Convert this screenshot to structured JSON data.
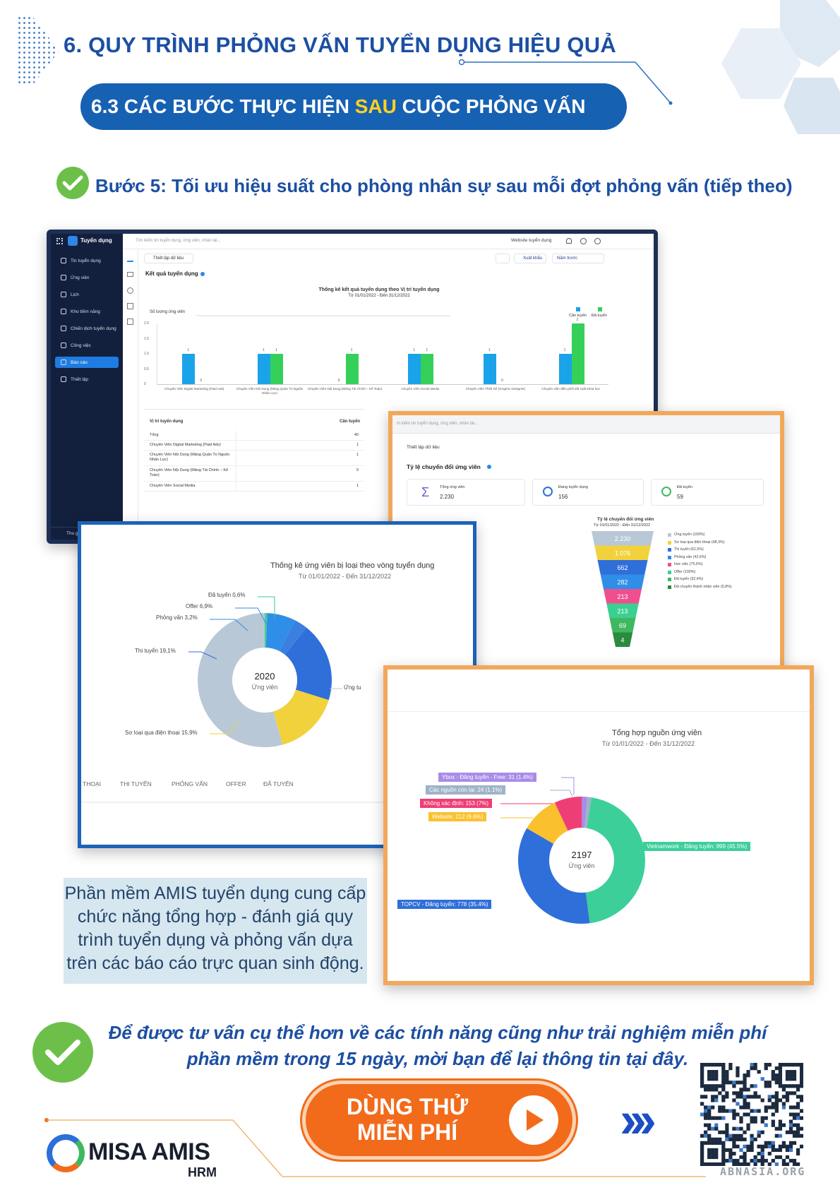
{
  "header": {
    "title": "6. QUY TRÌNH PHỎNG VẤN TUYỂN DỤNG HIỆU QUẢ",
    "subtitle_before": "6.3 CÁC BƯỚC THỰC HIỆN ",
    "subtitle_highlight": "SAU",
    "subtitle_after": " CUỘC PHỎNG VẤN"
  },
  "step": {
    "label": "Bước 5: Tối ưu hiệu suất cho phòng nhân sự sau mỗi đợt phỏng vấn (tiếp theo)"
  },
  "app_screen": {
    "brand": "Tuyển dụng",
    "search_placeholder": "Tìm kiếm tin tuyển dụng, ứng viên, nhân tài...",
    "website_btn": "Website tuyển dụng",
    "sidebar": [
      "Tin tuyển dụng",
      "Ứng viên",
      "Lịch",
      "Kho tiềm năng",
      "Chiến dịch tuyển dụng",
      "Công việc",
      "Báo cáo",
      "Thiết lập"
    ],
    "collapse_label": "Thu gọn",
    "setup_btn": "Thiết lập dữ liệu",
    "export_btn": "Xuất khẩu",
    "period": "Năm trước",
    "section_title": "Kết quả tuyển dụng",
    "chart": {
      "title": "Thống kê kết quả tuyển dụng theo Vị trí tuyển dụng",
      "date": "Từ 01/01/2022 - Đến 31/12/2022",
      "ylabel": "Số lượng ứng viên",
      "legend": [
        "Cần tuyển",
        "Đã tuyển"
      ],
      "yticks": [
        "2.0",
        "1.5",
        "1.0",
        "0.5",
        "0"
      ],
      "categories": [
        "Chuyên Viên Digital Marketing (Paid Ads)",
        "Chuyên Viên Nội Dung (Mảng Quản Trị Nguồn Nhân Lực)",
        "Chuyên Viên Nội Dung (Mảng Tài Chính – Kế Toán)",
        "Chuyên Viên Social Media",
        "Chuyên Viên Thiết Kế (Graphic Designer)",
        "Chuyên viên điều phối sắt xuất khóa học"
      ],
      "can_tuyen": [
        1,
        1,
        0,
        1,
        1,
        1
      ],
      "da_tuyen": [
        0,
        1,
        1,
        1,
        0,
        2
      ],
      "labels_can": [
        "1",
        "1",
        "0",
        "1",
        "1",
        "1"
      ],
      "labels_da": [
        "0",
        "1",
        "1",
        "1",
        "0",
        "2"
      ]
    },
    "table": {
      "col1": "Vị trí tuyển dụng",
      "col2": "Cần tuyển",
      "rows": [
        [
          "Tổng",
          "40"
        ],
        [
          "Chuyên Viên Digital Marketing (Paid Ads)",
          "1"
        ],
        [
          "Chuyên Viên Nội Dung (Mảng Quản Trị Nguồn Nhân Lực)",
          "1"
        ],
        [
          "Chuyên Viên Nội Dung (Mảng Tài Chính – Kế Toán)",
          "0"
        ],
        [
          "Chuyên Viên Social Media",
          "1"
        ]
      ]
    }
  },
  "funnel_screen": {
    "search_placeholder": "m kiếm tin tuyển dụng, ứng viên, nhân tài...",
    "setup_btn": "Thiết lập dữ liệu",
    "section_title": "Tỷ lệ chuyển đổi ứng viên",
    "kpis": [
      {
        "label": "Tổng ứng viên",
        "value": "2.230"
      },
      {
        "label": "Đang tuyển dụng",
        "value": "156"
      },
      {
        "label": "Đã tuyển",
        "value": "59"
      }
    ],
    "chart_title": "Tỷ lệ chuyển đổi ứng viên",
    "chart_date": "Từ 01/01/2022 - Đến 31/12/2022",
    "levels": [
      "2.230",
      "1.076",
      "662",
      "282",
      "213",
      "213",
      "69",
      "4"
    ],
    "legend": [
      "Ứng tuyển (100%)",
      "Sơ loại qua điện thoại (48,3%)",
      "Thi tuyển (61,5%)",
      "Phỏng vấn (42,6%)",
      "Học việc (75,5%)",
      "Offer (100%)",
      "Đã tuyển (32,4%)",
      "Đã chuyển thành nhân viên (5,8%)"
    ],
    "colors": [
      "#b9c8d6",
      "#f2d23c",
      "#2f6fd9",
      "#2f8ee8",
      "#ef4f8f",
      "#3ccf92",
      "#3fb85f",
      "#2b8a3e"
    ]
  },
  "donut1": {
    "title": "Thống kê ứng viên bị loại theo vòng tuyển dụng",
    "date": "Từ 01/01/2022 - Đến 31/12/2022",
    "center_value": "2020",
    "center_label": "Ứng viên",
    "labels": [
      "Đã tuyển  0,6%",
      "Offer 6,9%",
      "Phỏng vấn 3,2%",
      "Thi tuyển  19,1%",
      "Sơ loại qua điện thoại 15,9%",
      "Ứng tu"
    ],
    "tabs": [
      "THOẠI",
      "THI TUYỂN",
      "PHỎNG VẤN",
      "OFFER",
      "ĐÃ TUYỂN"
    ]
  },
  "donut2": {
    "title": "Tổng hợp nguồn ứng viên",
    "date": "Từ 01/01/2022 - Đến 31/12/2022",
    "center_value": "2197",
    "center_label": "Ứng viên",
    "labels": [
      "Ybox - Đăng tuyển - Free: 31 (1.4%)",
      "Các nguồn còn lại: 24 (1.1%)",
      "Không xác định: 153 (7%)",
      "Website: 212 (9.6%)",
      "Vietnamwork - Đăng tuyển: 999 (45.5%)",
      "TOPCV - Đăng tuyển: 778 (35.4%)"
    ],
    "label_colors": [
      "#a98be8",
      "#9fb3c8",
      "#ef3e76",
      "#fbc02d",
      "#3ccf9a",
      "#2f6fd9"
    ]
  },
  "chart_data": [
    {
      "type": "bar",
      "title": "Thống kê kết quả tuyển dụng theo Vị trí tuyển dụng",
      "ylabel": "Số lượng ứng viên",
      "categories": [
        "Chuyên Viên Digital Marketing (Paid Ads)",
        "Chuyên Viên Nội Dung (Mảng Quản Trị Nguồn Nhân Lực)",
        "Chuyên Viên Nội Dung (Mảng Tài Chính – Kế Toán)",
        "Chuyên Viên Social Media",
        "Chuyên Viên Thiết Kế (Graphic Designer)",
        "Chuyên viên điều phối sắt xuất khóa học"
      ],
      "series": [
        {
          "name": "Cần tuyển",
          "values": [
            1,
            1,
            0,
            1,
            1,
            1
          ]
        },
        {
          "name": "Đã tuyển",
          "values": [
            0,
            1,
            1,
            1,
            0,
            2
          ]
        }
      ],
      "ylim": [
        0,
        2
      ]
    },
    {
      "type": "pie",
      "title": "Thống kê ứng viên bị loại theo vòng tuyển dụng",
      "categories": [
        "Ứng tuyển",
        "Sơ loại qua điện thoại",
        "Thi tuyển",
        "Phỏng vấn",
        "Offer",
        "Đã tuyển"
      ],
      "values": [
        54.3,
        15.9,
        19.1,
        3.2,
        6.9,
        0.6
      ]
    },
    {
      "type": "pie",
      "title": "Tổng hợp nguồn ứng viên",
      "categories": [
        "Vietnamwork - Đăng tuyển",
        "TOPCV - Đăng tuyển",
        "Website",
        "Không xác định",
        "Ybox - Đăng tuyển - Free",
        "Các nguồn còn lại"
      ],
      "values": [
        999,
        778,
        212,
        153,
        31,
        24
      ]
    }
  ],
  "caption": {
    "lines": [
      "Phần mềm AMIS tuyển dụng cung cấp",
      "chức năng tổng hợp - đánh giá quy",
      "trình tuyển dụng và phỏng vấn dựa",
      "trên các báo cáo trực quan sinh động."
    ]
  },
  "cta": {
    "line1": "Để được tư vấn cụ thể hơn về các tính năng cũng như trải nghiệm miễn phí",
    "line2": "phần mềm trong 15 ngày, mời bạn để lại thông tin tại đây.",
    "button_line1": "DÙNG THỬ",
    "button_line2": "MIỄN PHÍ",
    "arrows": "›››"
  },
  "logo": {
    "brand": "MISA AMIS",
    "sub": "HRM"
  },
  "watermark": "ABNASIA.ORG"
}
